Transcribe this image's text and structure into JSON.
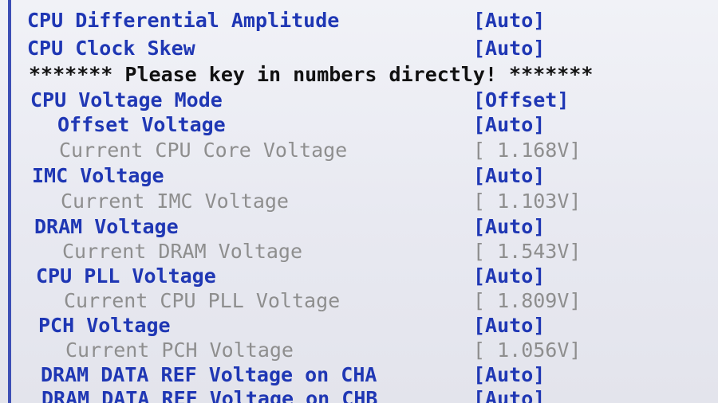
{
  "settings": [
    {
      "label": "CPU Differential Amplitude",
      "value": "[Auto]"
    },
    {
      "label": "CPU Clock Skew",
      "value": "[Auto]"
    },
    {
      "label": "CPU Voltage Mode",
      "value": "[Offset]"
    },
    {
      "label": "Offset Voltage",
      "value": "[Auto]"
    },
    {
      "label": "Current CPU Core Voltage",
      "value": "[ 1.168V]"
    },
    {
      "label": "IMC Voltage",
      "value": "[Auto]"
    },
    {
      "label": "Current IMC Voltage",
      "value": "[ 1.103V]"
    },
    {
      "label": "DRAM Voltage",
      "value": "[Auto]"
    },
    {
      "label": "Current DRAM Voltage",
      "value": "[ 1.543V]"
    },
    {
      "label": "CPU PLL Voltage",
      "value": "[Auto]"
    },
    {
      "label": "Current CPU PLL Voltage",
      "value": "[ 1.809V]"
    },
    {
      "label": "PCH Voltage",
      "value": "[Auto]"
    },
    {
      "label": "Current PCH Voltage",
      "value": "[ 1.056V]"
    },
    {
      "label": "DRAM DATA REF Voltage on CHA",
      "value": "[Auto]"
    },
    {
      "label": "DRAM DATA REF Voltage on CHB",
      "value": "[Auto]"
    }
  ],
  "notice": "******* Please key in numbers directly! *******",
  "colors": {
    "background": "#e9eaf2",
    "setting_text": "#1f37b4",
    "readonly_text": "#8e8e8e",
    "notice_text": "#111111"
  }
}
